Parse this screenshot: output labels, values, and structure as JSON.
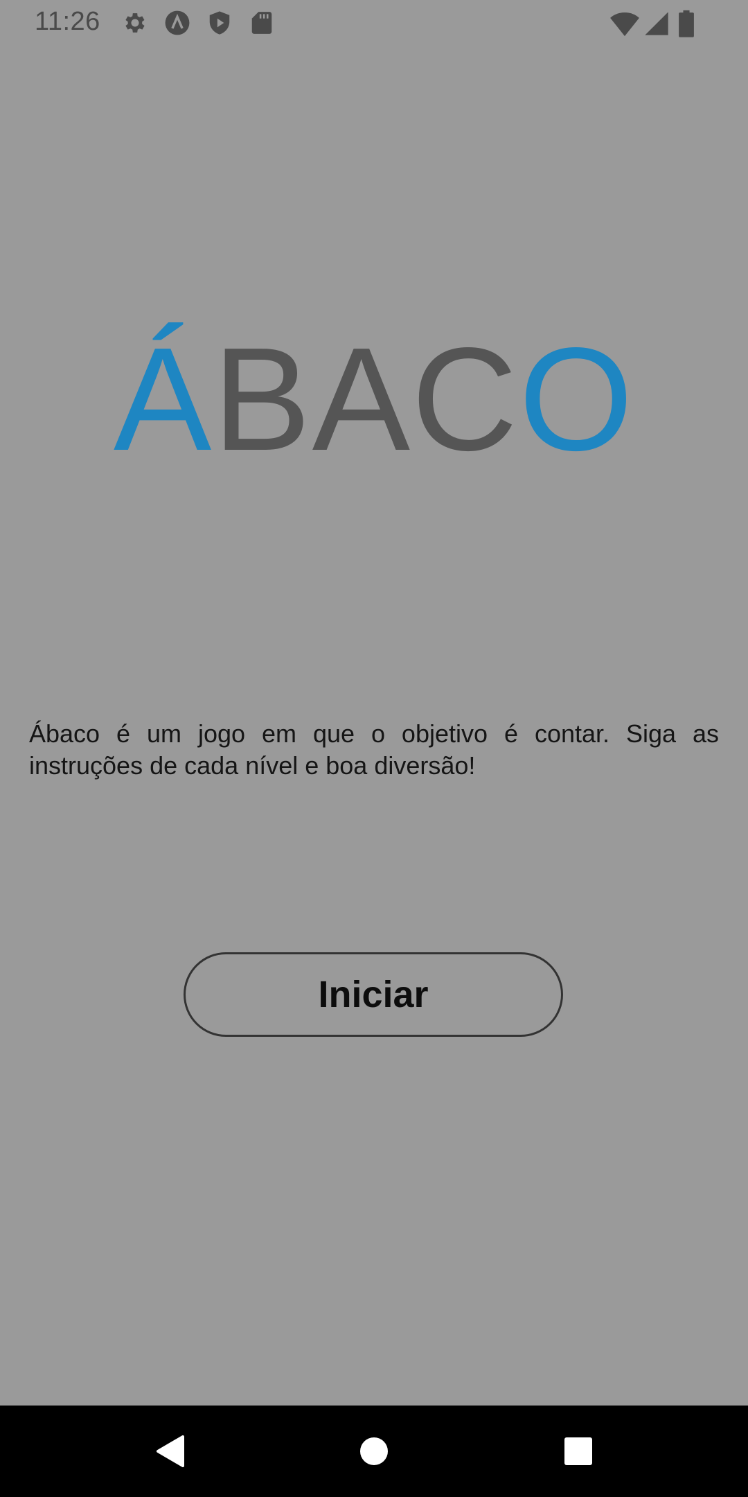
{
  "status_bar": {
    "time": "11:26",
    "left_icons": [
      "settings-icon",
      "a-badge-icon",
      "play-shield-icon",
      "sd-card-icon"
    ],
    "right_icons": [
      "wifi-icon",
      "cell-signal-icon",
      "battery-icon"
    ]
  },
  "title": {
    "first_letter": "Á",
    "middle": "BAC",
    "last_letter": "O",
    "accent_color": "#1e86c2",
    "base_color": "#555555"
  },
  "description": "Ábaco é um jogo em que o objetivo é contar. Siga as instruções de cada nível e boa diversão!",
  "start_button": {
    "label": "Iniciar"
  },
  "navigation": {
    "items": [
      "back-icon",
      "home-icon",
      "recents-icon"
    ]
  },
  "colors": {
    "background": "#9a9a9a",
    "nav_bar": "#000000"
  }
}
